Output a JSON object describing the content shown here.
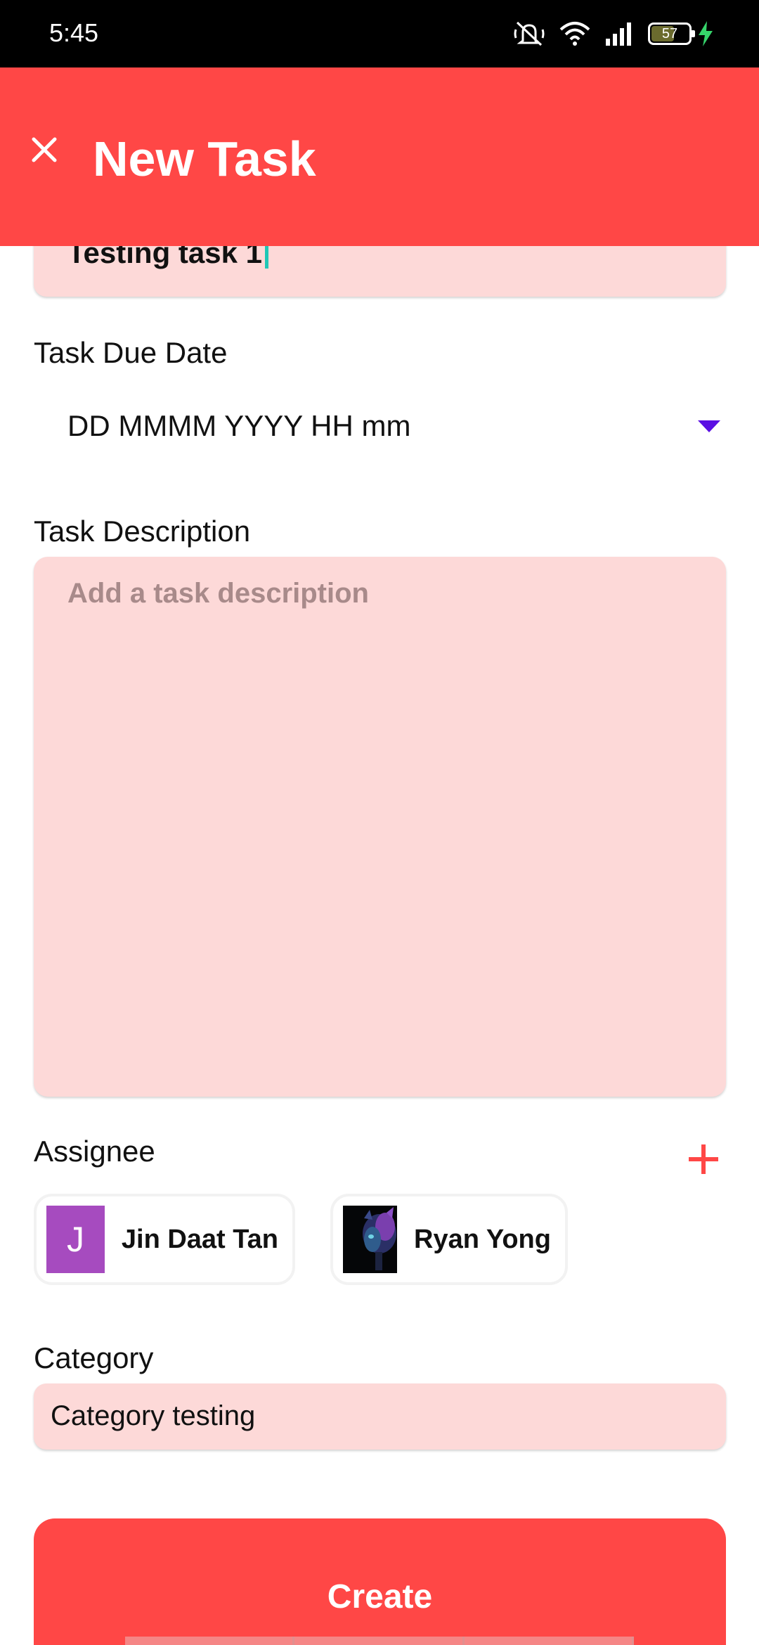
{
  "status_bar": {
    "time": "5:45",
    "battery_level": "57",
    "icons": [
      "mute-icon",
      "wifi-icon",
      "signal-icon",
      "battery-icon",
      "charging-icon"
    ]
  },
  "app_bar": {
    "title": "New Task",
    "close_icon": "close-icon",
    "background_color": "#ff4746"
  },
  "form": {
    "task_title_value": "Testing task 1",
    "due_date": {
      "label": "Task Due Date",
      "value": "DD MMMM YYYY HH mm",
      "arrow_icon": "dropdown-arrow-icon"
    },
    "description": {
      "label": "Task Description",
      "placeholder": "Add a task description"
    },
    "assignee": {
      "label": "Assignee",
      "add_icon": "plus-icon",
      "people": [
        {
          "initial": "J",
          "name": "Jin Daat Tan",
          "avatar_color": "#a64bbf"
        },
        {
          "name": "Ryan Yong"
        }
      ]
    },
    "category": {
      "label": "Category",
      "value": "Category testing"
    }
  },
  "actions": {
    "create_label": "Create"
  },
  "colors": {
    "accent": "#ff4746",
    "field_bg": "#fdd9d8",
    "dropdown_arrow": "#5a0fe3",
    "caret": "#1fc7b6"
  }
}
